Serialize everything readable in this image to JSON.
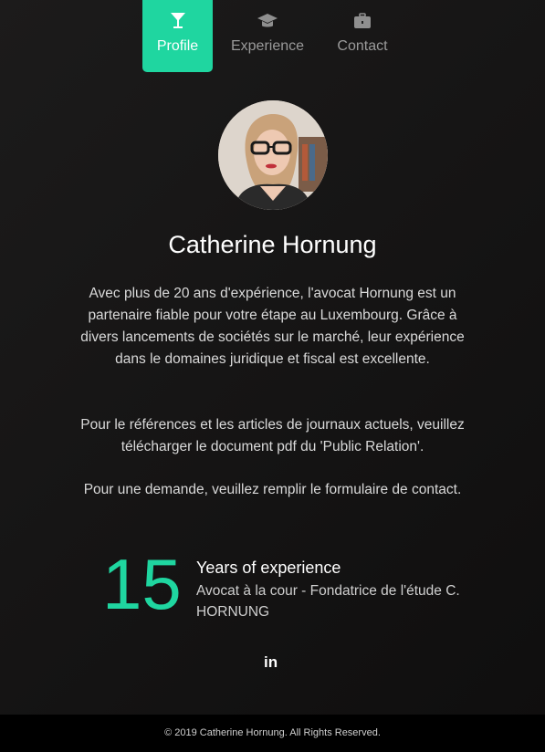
{
  "nav": {
    "items": [
      {
        "label": "Profile",
        "icon": "cocktail-glass-icon",
        "active": true
      },
      {
        "label": "Experience",
        "icon": "graduation-cap-icon",
        "active": false
      },
      {
        "label": "Contact",
        "icon": "briefcase-icon",
        "active": false
      }
    ]
  },
  "profile": {
    "name": "Catherine Hornung",
    "bio": [
      "Avec plus de 20 ans d'expérience, l'avocat Hornung est un partenaire fiable pour votre étape au Luxembourg. Grâce à divers lancements de sociétés sur le marché, leur expérience dans le domaines juridique et fiscal est excellente.",
      "Pour le références et les articles de journaux actuels, veuillez télécharger le document pdf du 'Public Relation'.",
      "Pour une demande, veuillez remplir le formulaire de contact."
    ]
  },
  "experience": {
    "years": "15",
    "title": "Years of experience",
    "subtitle": "Avocat à la cour - Fondatrice de l'étude C. HORNUNG"
  },
  "social": {
    "linkedin_label": "in"
  },
  "footer": {
    "copyright": "© 2019 Catherine Hornung. All Rights Reserved."
  },
  "colors": {
    "accent": "#1fd6a0",
    "background": "#161515",
    "footer": "#000000"
  }
}
